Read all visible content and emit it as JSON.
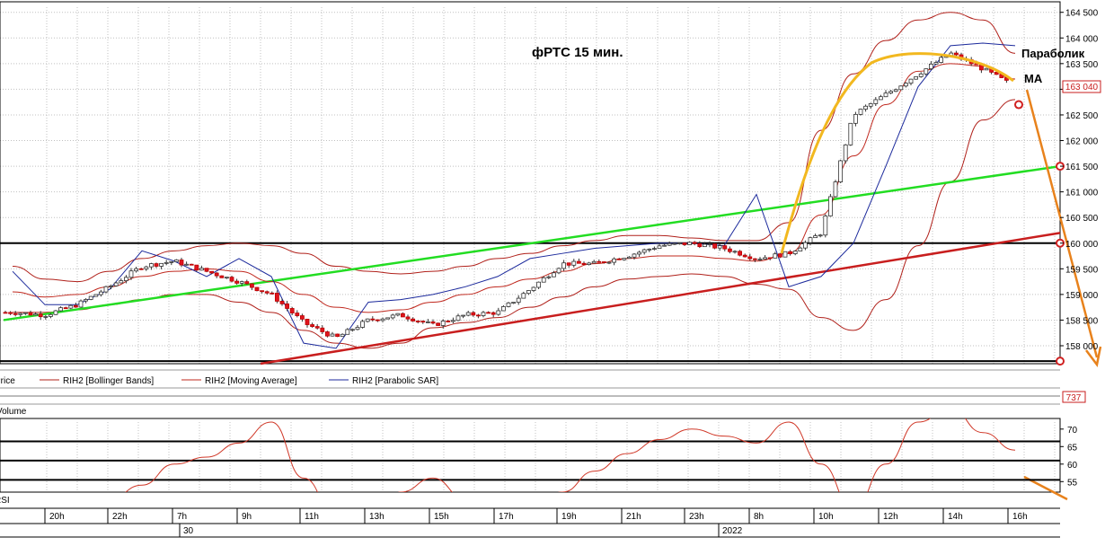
{
  "colors": {
    "candle_up": "#ffffff",
    "candle_down": "#e0141e",
    "bollinger": "#b0201a",
    "moving_average": "#c0281e",
    "parabolic_sar": "#1c2a9c",
    "green_line": "#22dd22",
    "red_line": "#c81e1e",
    "yellow_line": "#f2b81f",
    "orange_arrow": "#e8821c",
    "rsi_line": "#d03828",
    "grid": "#c0c0c0"
  },
  "chart_data": [
    {
      "type": "line",
      "title": "фРТС   15 мин.",
      "y_axis_side": "right",
      "ylim": [
        157650,
        164600
      ],
      "y_ticks": [
        158000,
        158500,
        159000,
        159500,
        160000,
        160500,
        161000,
        161500,
        162000,
        162500,
        163000,
        163500,
        164000,
        164500
      ],
      "y_tick_labels": [
        "158 000",
        "158 500",
        "159 000",
        "159 500",
        "160 000",
        "160 500",
        "161 000",
        "161 500",
        "162 000",
        "162 500",
        "163 000",
        "163 500",
        "164 000",
        "164 500"
      ],
      "last_price_label": "163 040",
      "horizontal_levels": [
        160000,
        157700
      ],
      "annotations": [
        "Параболик",
        "МА"
      ],
      "legend": [
        "Price",
        "RIH2 [Bollinger Bands]",
        "RIH2 [Moving Average]",
        "RIH2 [Parabolic SAR]"
      ],
      "series": [
        {
          "name": "RIH2 [Bollinger Bands]",
          "upper": [
            159550,
            159300,
            159250,
            159450,
            159700,
            159850,
            159950,
            160000,
            159950,
            159800,
            159550,
            159450,
            159400,
            159450,
            159550,
            159700,
            159800,
            159950,
            160050,
            160150,
            160150,
            160100,
            160050,
            160050,
            160400,
            162200,
            163300,
            163950,
            164350,
            164500,
            164350,
            163700
          ],
          "lower": [
            158650,
            158650,
            158700,
            158800,
            158900,
            159000,
            159000,
            158850,
            158650,
            158300,
            158050,
            157950,
            158050,
            158350,
            158450,
            158550,
            158750,
            158950,
            159150,
            159300,
            159350,
            159400,
            159350,
            159200,
            159100,
            158550,
            158300,
            158900,
            159950,
            161200,
            162400,
            162800
          ]
        },
        {
          "name": "RIH2 [Moving Average]",
          "values": [
            159050,
            158950,
            159000,
            159150,
            159350,
            159450,
            159500,
            159450,
            159250,
            159000,
            158750,
            158650,
            158700,
            158850,
            159000,
            159150,
            159300,
            159450,
            159600,
            159700,
            159750,
            159750,
            159700,
            159650,
            159800,
            160550,
            161700,
            162700,
            163350,
            163500,
            163450,
            163200
          ]
        },
        {
          "name": "RIH2 [Parabolic SAR]",
          "values": [
            159450,
            158800,
            158800,
            159100,
            159850,
            159650,
            159350,
            159700,
            159350,
            158050,
            157950,
            158850,
            158900,
            159000,
            159150,
            159350,
            159700,
            159800,
            159900,
            159950,
            160000,
            160000,
            159950,
            160950,
            159150,
            159350,
            160000,
            161500,
            163050,
            163850,
            163900,
            163850
          ]
        },
        {
          "name": "Price",
          "values": [
            158650,
            158600,
            158800,
            159150,
            159550,
            159650,
            159450,
            159250,
            159000,
            158450,
            158150,
            158500,
            158600,
            158400,
            158600,
            158650,
            159100,
            159600,
            159600,
            159750,
            159950,
            160000,
            159900,
            159700,
            159800,
            160200,
            162500,
            162900,
            163300,
            163700,
            163400,
            163050
          ]
        }
      ]
    },
    {
      "type": "line",
      "title": "",
      "panel_label": "Volume",
      "value_label": "737"
    },
    {
      "type": "line",
      "panel_label": "RSI",
      "ylim": [
        52,
        72
      ],
      "y_ticks": [
        55,
        60,
        65,
        70
      ],
      "y_tick_labels": [
        "55",
        "60",
        "65",
        "70"
      ],
      "horizontal_levels": [
        55.5,
        61,
        66.5
      ],
      "series": [
        {
          "name": "RSI",
          "values": [
            48,
            50,
            50,
            50,
            54,
            60,
            62,
            66,
            72,
            56,
            45,
            40,
            52,
            56,
            50,
            48,
            48,
            52,
            58,
            63,
            67,
            70,
            68,
            66,
            72,
            60,
            47,
            60,
            72,
            76,
            69,
            64
          ]
        }
      ]
    }
  ],
  "time_axis": {
    "hour_labels": [
      "20h",
      "22h",
      "7h",
      "9h",
      "11h",
      "13h",
      "15h",
      "17h",
      "19h",
      "21h",
      "23h",
      "8h",
      "10h",
      "12h",
      "14h",
      "16h"
    ],
    "day_labels": [
      "30",
      "2022"
    ]
  }
}
